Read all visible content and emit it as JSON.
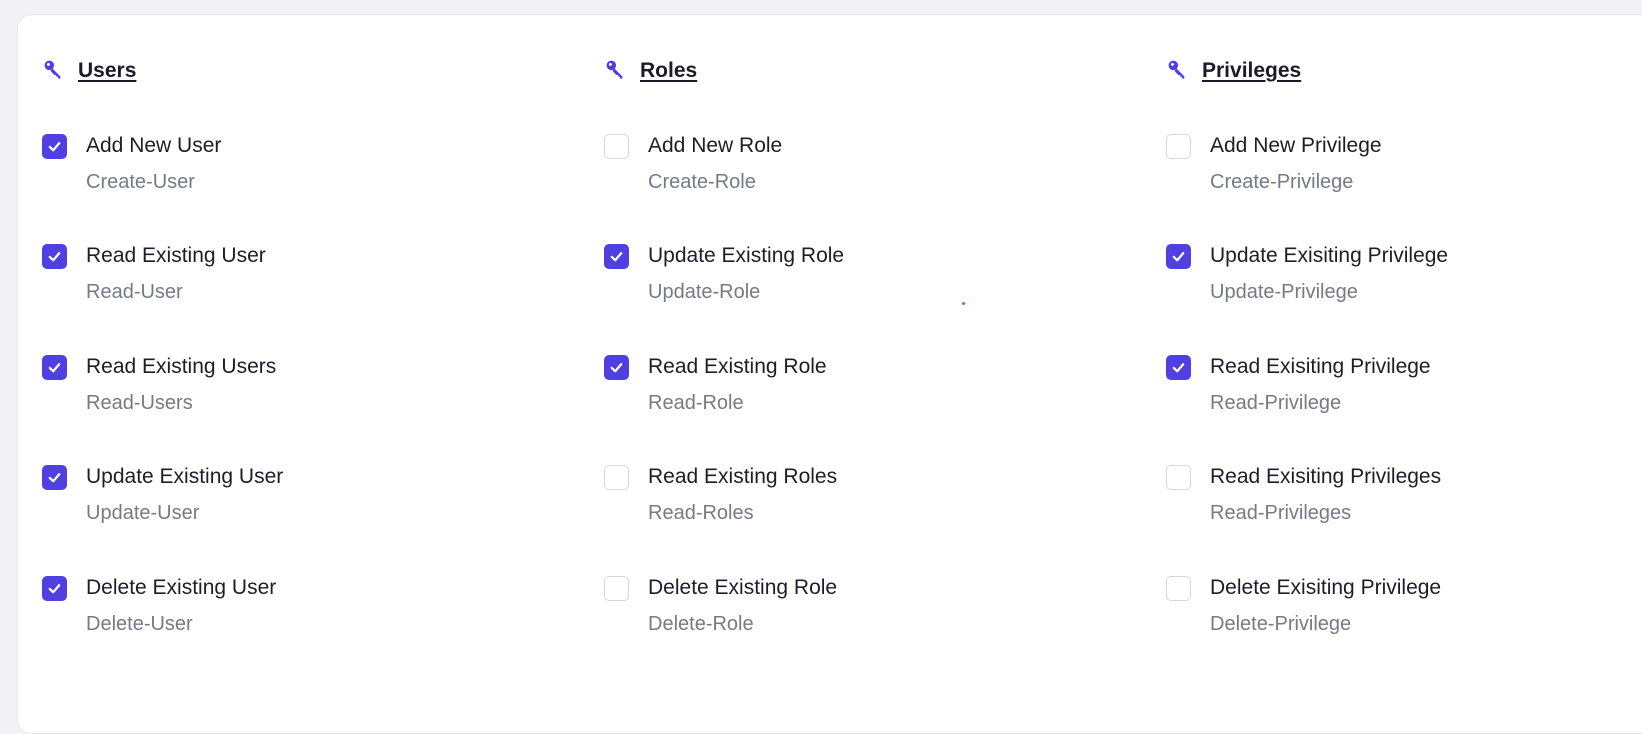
{
  "colors": {
    "accent": "#5040e2",
    "title_text": "#1b1b2a",
    "code_text": "#777a86"
  },
  "columns": [
    {
      "title": "Users",
      "icon": "key-icon",
      "items": [
        {
          "label": "Add New User",
          "code": "Create-User",
          "checked": true
        },
        {
          "label": "Read Existing User",
          "code": "Read-User",
          "checked": true
        },
        {
          "label": "Read Existing Users",
          "code": "Read-Users",
          "checked": true
        },
        {
          "label": "Update Existing User",
          "code": "Update-User",
          "checked": true
        },
        {
          "label": "Delete Existing User",
          "code": "Delete-User",
          "checked": true
        }
      ]
    },
    {
      "title": "Roles",
      "icon": "key-icon",
      "items": [
        {
          "label": "Add New Role",
          "code": "Create-Role",
          "checked": false
        },
        {
          "label": "Update Existing Role",
          "code": "Update-Role",
          "checked": true
        },
        {
          "label": "Read Existing Role",
          "code": "Read-Role",
          "checked": true
        },
        {
          "label": "Read Existing Roles",
          "code": "Read-Roles",
          "checked": false
        },
        {
          "label": "Delete Existing Role",
          "code": "Delete-Role",
          "checked": false
        }
      ]
    },
    {
      "title": "Privileges",
      "icon": "key-icon",
      "items": [
        {
          "label": "Add New Privilege",
          "code": "Create-Privilege",
          "checked": false
        },
        {
          "label": "Update Exisiting Privilege",
          "code": "Update-Privilege",
          "checked": true
        },
        {
          "label": "Read Exisiting Privilege",
          "code": "Read-Privilege",
          "checked": true
        },
        {
          "label": "Read Exisiting Privileges",
          "code": "Read-Privileges",
          "checked": false
        },
        {
          "label": "Delete Exisiting Privilege",
          "code": "Delete-Privilege",
          "checked": false
        }
      ]
    }
  ]
}
